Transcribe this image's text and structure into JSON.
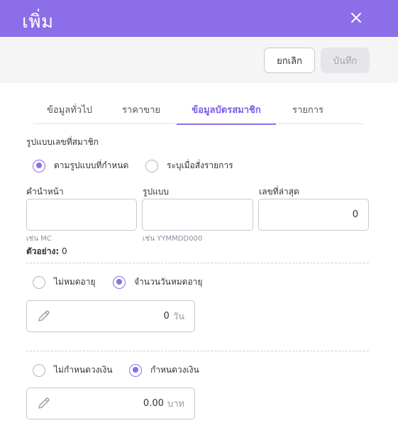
{
  "header": {
    "title": "เพิ่ม",
    "close_icon": "close-icon"
  },
  "toolbar": {
    "cancel_label": "ยกเลิก",
    "save_label": "บันทึก"
  },
  "tabs": [
    {
      "label": "ข้อมูลทั่วไป",
      "active": false
    },
    {
      "label": "ราคาขาย",
      "active": false
    },
    {
      "label": "ข้อมูลบัตรสมาชิก",
      "active": true
    },
    {
      "label": "รายการ",
      "active": false
    }
  ],
  "member_format": {
    "section_label": "รูปแบบเลขที่สมาชิก",
    "options": [
      {
        "label": "ตามรูปแบบที่กำหนด",
        "checked": true
      },
      {
        "label": "ระบุเมื่อสั่งรายการ",
        "checked": false
      }
    ],
    "fields": {
      "prefix": {
        "label": "คำนำหน้า",
        "value": "",
        "hint": "เช่น MC"
      },
      "pattern": {
        "label": "รูปแบบ",
        "value": "",
        "hint": "เช่น YYMMDD000"
      },
      "latest": {
        "label": "เลขที่ล่าสุด",
        "value": "0"
      }
    },
    "example_label": "ตัวอย่าง:",
    "example_value": "0"
  },
  "expiry": {
    "options": [
      {
        "label": "ไม่หมดอายุ",
        "checked": false
      },
      {
        "label": "จำนวนวันหมดอายุ",
        "checked": true
      }
    ],
    "value": "0",
    "unit": "วัน",
    "icon": "pencil-icon"
  },
  "credit": {
    "options": [
      {
        "label": "ไม่กำหนดวงเงิน",
        "checked": false
      },
      {
        "label": "กำหนดวงเงิน",
        "checked": true
      }
    ],
    "value": "0.00",
    "unit": "บาท",
    "icon": "pencil-icon"
  },
  "colors": {
    "accent": "#8b6ee8",
    "header_bg": "#8b6ee8",
    "toolbar_bg": "#f5f5f6"
  }
}
